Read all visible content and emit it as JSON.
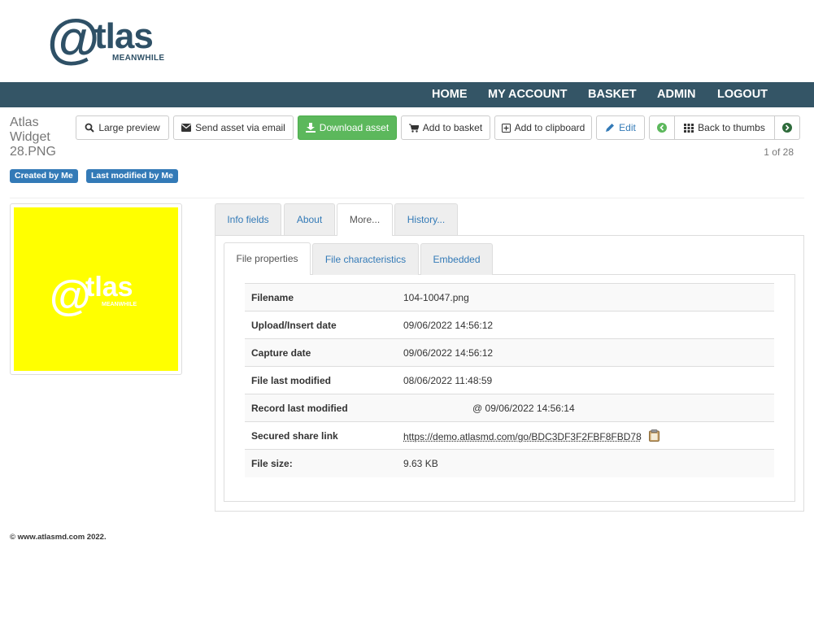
{
  "brand": {
    "logo_at": "@",
    "logo_tlas": "tlas",
    "logo_sub": "MEANWHILE"
  },
  "nav": {
    "home": "HOME",
    "my_account": "MY ACCOUNT",
    "basket": "BASKET",
    "admin": "ADMIN",
    "logout": "LOGOUT"
  },
  "asset": {
    "title_line1": "Atlas",
    "title_line2": "Widget",
    "title_line3": "28.PNG"
  },
  "toolbar": {
    "large_preview": "Large preview",
    "send_email": "Send asset via email",
    "download": "Download asset",
    "add_basket": "Add to basket",
    "add_clipboard": "Add to clipboard",
    "edit": "Edit",
    "back_to_thumbs": "Back to thumbs"
  },
  "pager": {
    "count": "1 of 28"
  },
  "badges": {
    "created": "Created by Me",
    "modified": "Last modified by Me"
  },
  "thumbnail": {
    "at": "@",
    "tlas": "tlas",
    "sub": "MEANWHILE",
    "background": "#ffff00"
  },
  "tabs": {
    "info_fields": "Info fields",
    "about": "About",
    "more": "More...",
    "history": "History..."
  },
  "subtabs": {
    "file_properties": "File properties",
    "file_characteristics": "File characteristics",
    "embedded": "Embedded"
  },
  "properties": [
    {
      "label": "Filename",
      "value": "104-10047.png"
    },
    {
      "label": "Upload/Insert date",
      "value": "09/06/2022 14:56:12"
    },
    {
      "label": "Capture date",
      "value": "09/06/2022 14:56:12"
    },
    {
      "label": "File last modified",
      "value": "08/06/2022 11:48:59"
    },
    {
      "label": "Record last modified",
      "value": "@ 09/06/2022 14:56:14"
    },
    {
      "label": "Secured share link",
      "value": "https://demo.atlasmd.com/go/BDC3DF3F2FBF8FBD78"
    },
    {
      "label": "File size:",
      "value": "9.63 KB"
    }
  ],
  "footer": {
    "copyright": "© www.atlasmd.com 2022."
  },
  "colors": {
    "navbar": "#345566",
    "brand": "#2e5066",
    "accent": "#337ab7",
    "success": "#5cb85c"
  },
  "icons": [
    "search-icon",
    "envelope-icon",
    "download-icon",
    "cart-icon",
    "plus-square-icon",
    "pencil-icon",
    "arrow-left-circle-icon",
    "grid-icon",
    "arrow-right-circle-icon",
    "clipboard-icon"
  ]
}
